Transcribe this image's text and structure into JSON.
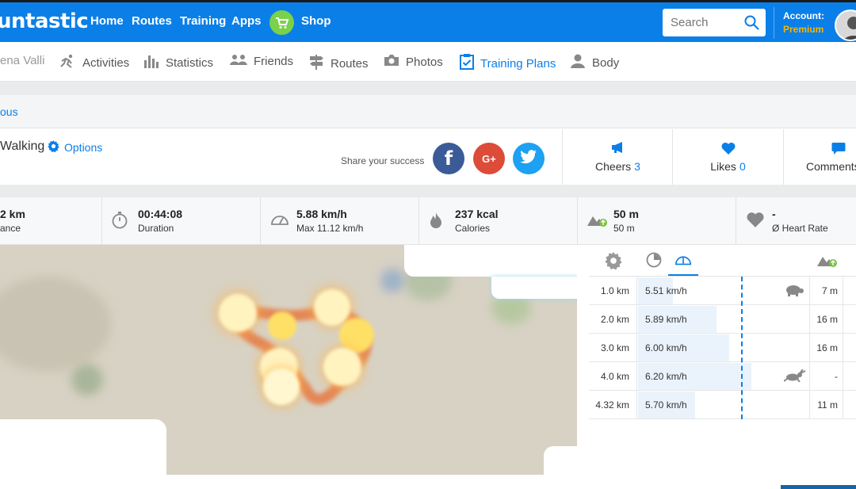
{
  "topbar": {
    "logo": "untastic",
    "nav": [
      "Home",
      "Routes",
      "Training",
      "Apps"
    ],
    "shop_label": "Shop",
    "search_placeholder": "Search",
    "account_label": "Account:",
    "account_tier": "Premium",
    "color_accent": "#0b7fe8",
    "color_premium": "#f5b400"
  },
  "subnav": {
    "user_name": "ena Valli",
    "items": [
      {
        "label": "Activities",
        "icon": "runner-icon"
      },
      {
        "label": "Statistics",
        "icon": "bar-chart-icon"
      },
      {
        "label": "Friends",
        "icon": "friends-icon"
      },
      {
        "label": "Routes",
        "icon": "signpost-icon"
      },
      {
        "label": "Photos",
        "icon": "camera-icon"
      },
      {
        "label": "Training Plans",
        "icon": "checklist-icon"
      },
      {
        "label": "Body",
        "icon": "person-icon"
      }
    ],
    "active": "Training Plans"
  },
  "breadcrumb": {
    "label": "ous"
  },
  "activity": {
    "title": "Walking",
    "options_label": "Options",
    "share_text": "Share your success",
    "social": [
      "facebook",
      "google-plus",
      "twitter"
    ]
  },
  "engagement": {
    "cheers_label": "Cheers",
    "cheers_count": "3",
    "likes_label": "Likes",
    "likes_count": "0",
    "comments_label": "Comments"
  },
  "metrics": [
    {
      "value": "2 km",
      "label": "ance",
      "icon": "distance-icon"
    },
    {
      "value": "00:44:08",
      "label": "Duration",
      "icon": "stopwatch-icon"
    },
    {
      "value": "5.88 km/h",
      "label": "Max 11.12 km/h",
      "icon": "speedometer-icon"
    },
    {
      "value": "237 kcal",
      "label": "Calories",
      "icon": "flame-icon"
    },
    {
      "value": "50 m",
      "label": "50 m",
      "icon": "elevation-icon"
    },
    {
      "value": "-",
      "label": "Ø Heart Rate",
      "icon": "heart-icon"
    }
  ],
  "splits": {
    "rows": [
      {
        "km": "1.0 km",
        "speed": "5.51 km/h",
        "speed_value": 5.51,
        "elev": "7 m",
        "marker": "turtle"
      },
      {
        "km": "2.0 km",
        "speed": "5.89 km/h",
        "speed_value": 5.89,
        "elev": "16 m",
        "marker": ""
      },
      {
        "km": "3.0 km",
        "speed": "6.00 km/h",
        "speed_value": 6.0,
        "elev": "16 m",
        "marker": ""
      },
      {
        "km": "4.0 km",
        "speed": "6.20 km/h",
        "speed_value": 6.2,
        "elev": "-",
        "marker": "rabbit"
      },
      {
        "km": "4.32 km",
        "speed": "5.70 km/h",
        "speed_value": 5.7,
        "elev": "11 m",
        "marker": ""
      }
    ],
    "average_speed_value": 5.88
  }
}
